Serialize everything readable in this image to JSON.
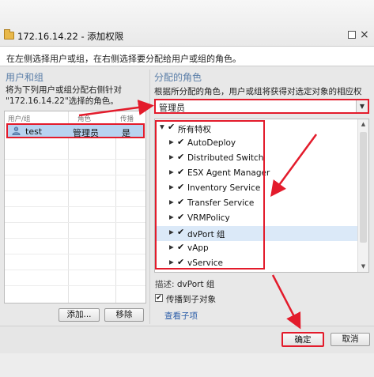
{
  "window": {
    "title": "172.16.14.22 - 添加权限",
    "folder_icon": "folder-icon",
    "max_icon": "maximize-icon",
    "close_glyph": "×"
  },
  "instruction": "在左侧选择用户或组，在右侧选择要分配给用户或组的角色。",
  "left_panel": {
    "header": "用户和组",
    "desc_line1": "将为下列用户或组分配右侧针对",
    "desc_line2": "\"172.16.14.22\"选择的角色。",
    "columns": [
      "用户/组",
      "角色",
      "传播"
    ],
    "rows": [
      {
        "icon": "user-icon",
        "name": "test",
        "role": "管理员",
        "propagate": "是"
      }
    ],
    "add_button": "添加...",
    "remove_button": "移除"
  },
  "right_panel": {
    "header": "分配的角色",
    "desc": "根据所分配的角色，用户或组将获得对选定对象的相应权限。",
    "role_select": {
      "value": "管理员",
      "arrow_glyph": "▼"
    },
    "privileges": [
      {
        "label": "所有特权",
        "expander": "▼",
        "check": "✔",
        "level": 0,
        "selected": false
      },
      {
        "label": "AutoDeploy",
        "expander": "▶",
        "check": "✔",
        "level": 1,
        "selected": false
      },
      {
        "label": "Distributed Switch",
        "expander": "▶",
        "check": "✔",
        "level": 1,
        "selected": false
      },
      {
        "label": "ESX Agent Manager",
        "expander": "▶",
        "check": "✔",
        "level": 1,
        "selected": false
      },
      {
        "label": "Inventory Service",
        "expander": "▶",
        "check": "✔",
        "level": 1,
        "selected": false
      },
      {
        "label": "Transfer Service",
        "expander": "▶",
        "check": "✔",
        "level": 1,
        "selected": false
      },
      {
        "label": "VRMPolicy",
        "expander": "▶",
        "check": "✔",
        "level": 1,
        "selected": false
      },
      {
        "label": "dvPort 组",
        "expander": "▶",
        "check": "✔",
        "level": 1,
        "selected": true
      },
      {
        "label": "vApp",
        "expander": "▶",
        "check": "✔",
        "level": 1,
        "selected": false
      },
      {
        "label": "vService",
        "expander": "▶",
        "check": "✔",
        "level": 1,
        "selected": false
      }
    ],
    "description_label": "描述:",
    "description_value": "dvPort 组",
    "propagate_label": "传播到子对象",
    "propagate_checked": true,
    "propagate_check_glyph": "✔",
    "view_children": "查看子项"
  },
  "footer": {
    "ok_button": "确定",
    "cancel_button": "取消"
  },
  "colors": {
    "annotation_red": "#e31b2b",
    "selection_blue": "#b8d3f0",
    "header_blue": "#5a7ea8"
  }
}
